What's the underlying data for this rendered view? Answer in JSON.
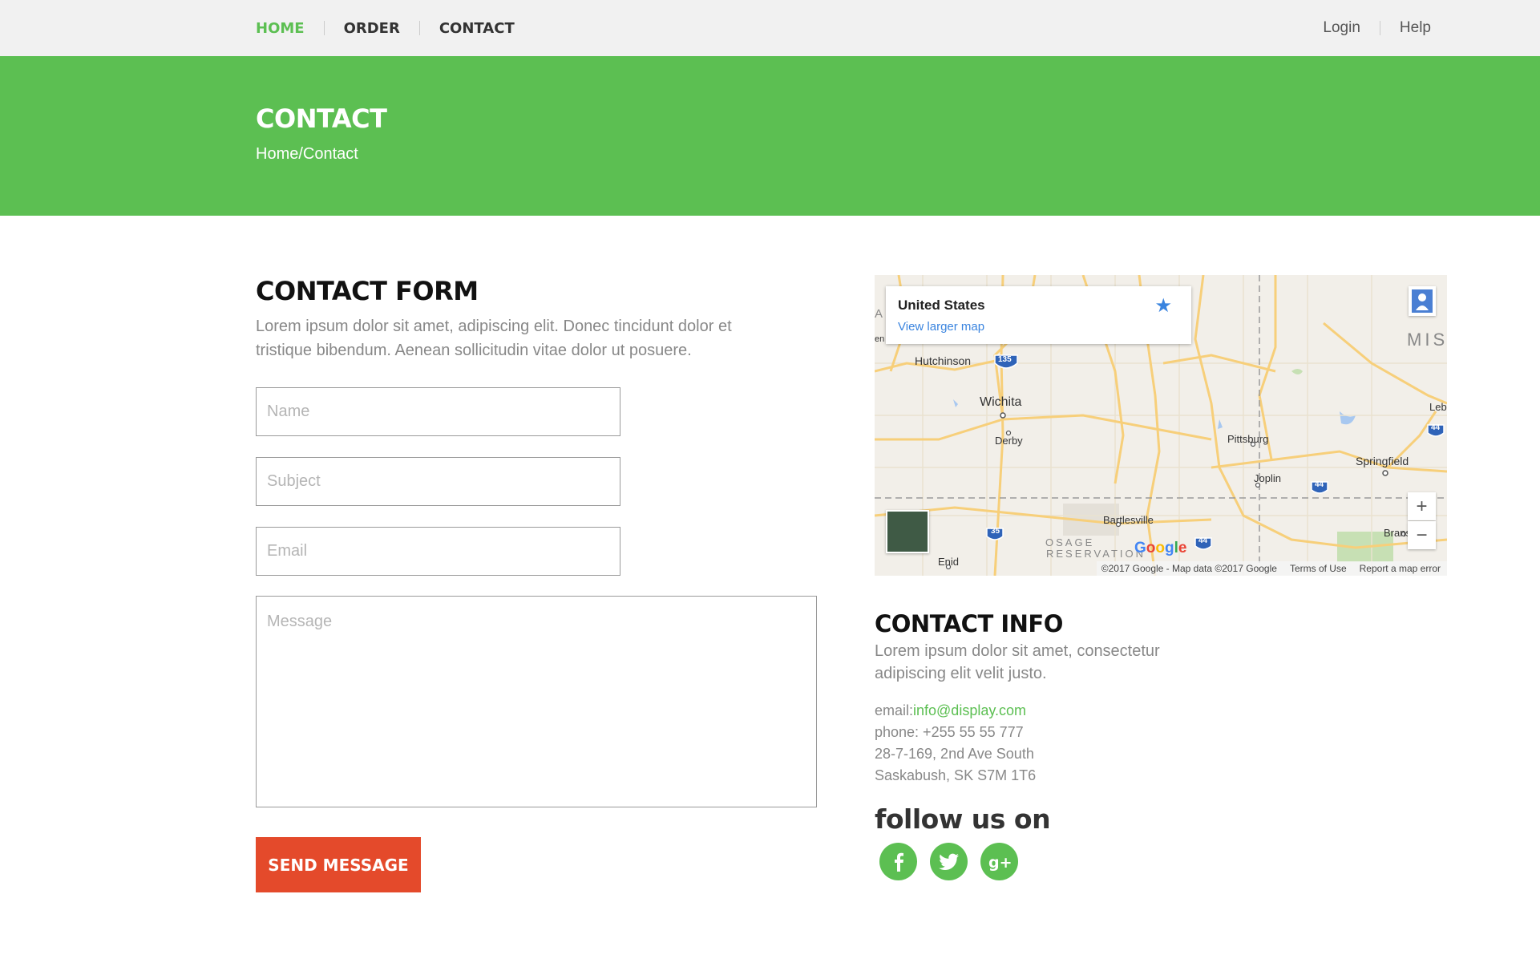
{
  "nav": {
    "home": "HOME",
    "order": "ORDER",
    "contact": "CONTACT",
    "login": "Login",
    "help": "Help"
  },
  "hero": {
    "title": "CONTACT",
    "breadcrumb": "Home/Contact"
  },
  "form": {
    "title": "CONTACT FORM",
    "description": "Lorem ipsum dolor sit amet, adipiscing elit. Donec tincidunt dolor et tristique bibendum. Aenean sollicitudin vitae dolor ut posuere.",
    "name_placeholder": "Name",
    "subject_placeholder": "Subject",
    "email_placeholder": "Email",
    "message_placeholder": "Message",
    "send_label": "SEND MESSAGE"
  },
  "map": {
    "card_title": "United States",
    "card_link": "View larger map",
    "zoom_in": "+",
    "zoom_out": "−",
    "labels": {
      "hutchinson": "Hutchinson",
      "wichita": "Wichita",
      "derby": "Derby",
      "pittsburg": "Pittsburg",
      "springfield": "Springfield",
      "joplin": "Joplin",
      "bartlesville": "Bartlesville",
      "osage": "OSAGE",
      "reservation": "RESERVATION",
      "enid": "Enid",
      "branson": "Branso",
      "lebanon": "Leba",
      "mis": "MIS",
      "a_edge": "A",
      "en_edge": "en"
    },
    "shields": {
      "s135": "135",
      "s35": "35",
      "s44a": "44",
      "s44b": "44",
      "s44c": "44"
    },
    "google": "Google",
    "footer_copyright": "©2017 Google - Map data ©2017 Google",
    "footer_terms": "Terms of Use",
    "footer_report": "Report a map error"
  },
  "info": {
    "title": "CONTACT INFO",
    "description": "Lorem ipsum dolor sit amet, consectetur adipiscing elit velit justo.",
    "email_label": "email:",
    "email_value": "info@display.com",
    "phone": "phone: +255 55 55 777",
    "address1": "28-7-169, 2nd Ave South",
    "address2": "Saskabush, SK S7M 1T6",
    "follow_title": "follow us on"
  },
  "colors": {
    "accent_green": "#5cbf52",
    "button_red": "#e44a2b"
  },
  "icons": {
    "facebook": "facebook-icon",
    "twitter": "twitter-icon",
    "google_plus": "google-plus-icon"
  }
}
